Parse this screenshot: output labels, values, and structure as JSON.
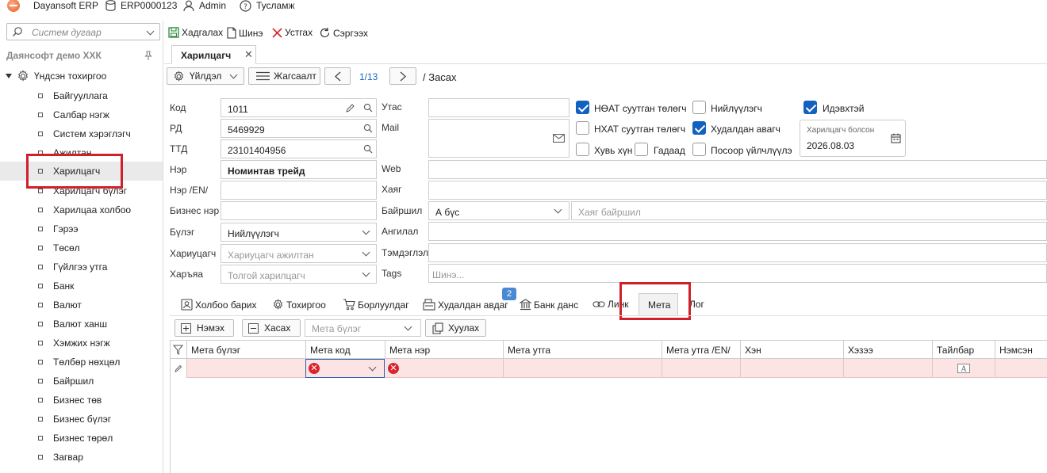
{
  "topbar": {
    "app_name": "Dayansoft ERP",
    "db_code": "ERP0000123",
    "user": "Admin",
    "help": "Тусламж"
  },
  "sidebar": {
    "search_placeholder": "Систем дугаар",
    "company": "Даянсофт демо ХХК",
    "root": "Үндсэн тохиргоо",
    "items": [
      {
        "label": "Байгууллага"
      },
      {
        "label": "Салбар нэгж"
      },
      {
        "label": "Систем хэрэглэгч"
      },
      {
        "label": "Ажилтан"
      },
      {
        "label": "Харилцагч"
      },
      {
        "label": "Харилцагч бүлэг"
      },
      {
        "label": "Харилцаа холбоо"
      },
      {
        "label": "Гэрээ"
      },
      {
        "label": "Төсөл"
      },
      {
        "label": "Гүйлгээ утга"
      },
      {
        "label": "Банк"
      },
      {
        "label": "Валют"
      },
      {
        "label": "Валют ханш"
      },
      {
        "label": "Хэмжих нэгж"
      },
      {
        "label": "Төлбөр нөхцөл"
      },
      {
        "label": "Байршил"
      },
      {
        "label": "Бизнес төв"
      },
      {
        "label": "Бизнес бүлэг"
      },
      {
        "label": "Бизнес төрөл"
      },
      {
        "label": "Загвар"
      }
    ]
  },
  "toolbar": {
    "save": "Хадгалах",
    "new": "Шинэ",
    "delete": "Устгах",
    "refresh": "Сэргээх"
  },
  "doc_tab": {
    "label": "Харилцагч"
  },
  "nav": {
    "action": "Үйлдэл",
    "list": "Жагсаалт",
    "page": "1/13",
    "mode": "/ Засах"
  },
  "form": {
    "code_label": "Код",
    "code_value": "1011",
    "rd_label": "РД",
    "rd_value": "5469929",
    "ttd_label": "ТТД",
    "ttd_value": "23101404956",
    "name_label": "Нэр",
    "name_value": "Номинтав трейд",
    "name_en_label": "Нэр /EN/",
    "biz_name_label": "Бизнес нэр",
    "group_label": "Бүлэг",
    "group_value": "Нийлүүлэгч",
    "resp_label": "Хариуцагч",
    "resp_placeholder": "Хариуцагч ажилтан",
    "parent_label": "Харъяа",
    "parent_placeholder": "Толгой харилцагч",
    "phone_label": "Утас",
    "mail_label": "Mail",
    "web_label": "Web",
    "addr_label": "Хаяг",
    "loc_label": "Байршил",
    "loc_value": "А бүс",
    "loc_addr_placeholder": "Хаяг байршил",
    "cat_label": "Ангилал",
    "note_label": "Тэмдэглэл",
    "tags_label": "Tags",
    "tags_placeholder": "Шинэ..."
  },
  "checks": {
    "vat_payer": {
      "label": "НӨАТ суутган төлөгч",
      "checked": true
    },
    "supplier": {
      "label": "Нийлүүлэгч",
      "checked": false
    },
    "active": {
      "label": "Идэвхтэй",
      "checked": true
    },
    "pit_payer": {
      "label": "НХАТ суутган төлөгч",
      "checked": false
    },
    "buyer": {
      "label": "Худалдан авагч",
      "checked": true
    },
    "person": {
      "label": "Хувь хүн",
      "checked": false
    },
    "foreign": {
      "label": "Гадаад",
      "checked": false
    },
    "service": {
      "label": "Посоор үйлчлүүлэ",
      "checked": false
    }
  },
  "since": {
    "label": "Харилцагч болсон",
    "value": "2026.08.03"
  },
  "subtabs": [
    {
      "label": "Холбоо барих"
    },
    {
      "label": "Тохиргоо"
    },
    {
      "label": "Борлуулдаг"
    },
    {
      "label": "Худалдан авдаг",
      "badge": "2"
    },
    {
      "label": "Банк данс"
    },
    {
      "label": "Линк"
    },
    {
      "label": "Мета"
    },
    {
      "label": "Лог"
    }
  ],
  "grid_toolbar": {
    "add": "Нэмэх",
    "remove": "Хасах",
    "group_placeholder": "Мета бүлэг",
    "copy": "Хуулах"
  },
  "grid": {
    "headers": [
      "Мета бүлэг",
      "Мета код",
      "Мета нэр",
      "Мета утга",
      "Мета утга /EN/",
      "Хэн",
      "Хэзээ",
      "Тайлбар",
      "Нэмсэн"
    ]
  }
}
